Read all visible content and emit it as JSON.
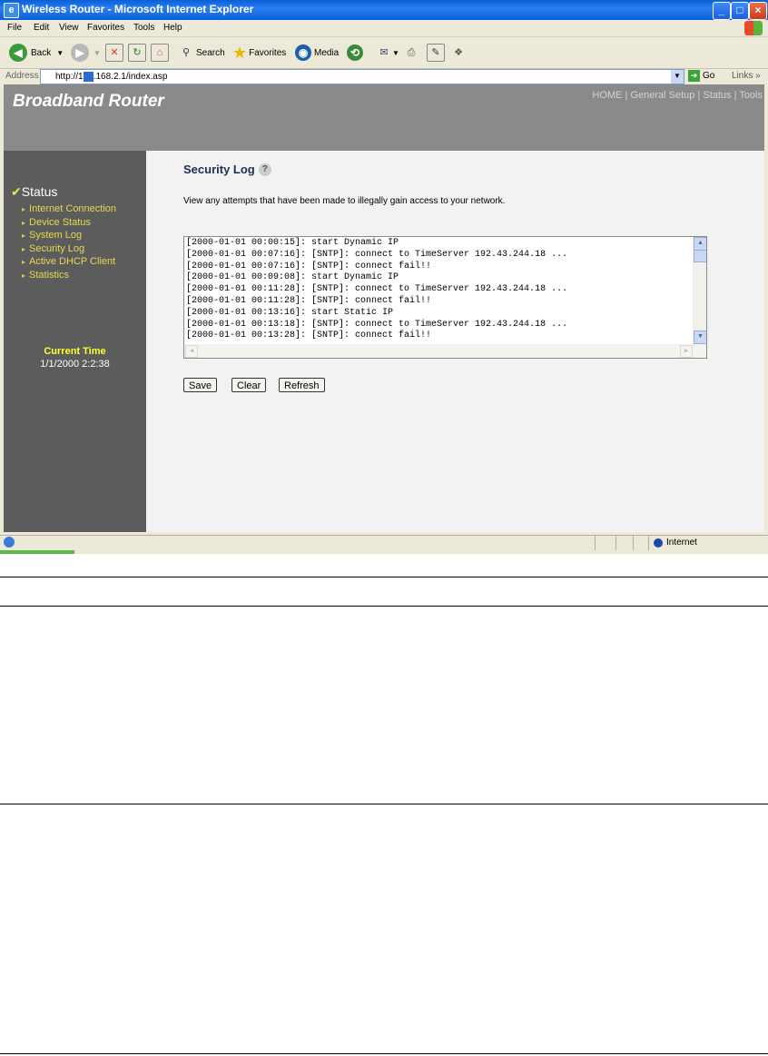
{
  "window": {
    "title": "Wireless Router - Microsoft Internet Explorer"
  },
  "menu": [
    "File",
    "Edit",
    "View",
    "Favorites",
    "Tools",
    "Help"
  ],
  "toolbar": {
    "back": "Back",
    "search": "Search",
    "favorites": "Favorites",
    "media": "Media"
  },
  "address": {
    "label": "Address",
    "url": "http://192.168.2.1/index.asp",
    "go": "Go",
    "links": "Links"
  },
  "header": {
    "brand": "Broadband Router",
    "nav": "HOME | General Setup | Status | Tools"
  },
  "sidebar": {
    "section": "Status",
    "items": [
      "Internet Connection",
      "Device Status",
      "System Log",
      "Security Log",
      "Active DHCP Client",
      "Statistics"
    ],
    "current_time_label": "Current Time",
    "current_time_value": "1/1/2000 2:2:38"
  },
  "main": {
    "title": "Security Log",
    "description": "View any attempts that have been made to illegally gain access to your network.",
    "log_lines": [
      "[2000-01-01 00:00:15]: start Dynamic IP",
      "[2000-01-01 00:07:16]: [SNTP]: connect to TimeServer 192.43.244.18 ...",
      "[2000-01-01 00:07:16]: [SNTP]: connect fail!!",
      "[2000-01-01 00:09:08]: start Dynamic IP",
      "[2000-01-01 00:11:28]: [SNTP]: connect to TimeServer 192.43.244.18 ...",
      "[2000-01-01 00:11:28]: [SNTP]: connect fail!!",
      "[2000-01-01 00:13:16]: start Static IP",
      "[2000-01-01 00:13:18]: [SNTP]: connect to TimeServer 192.43.244.18 ...",
      "[2000-01-01 00:13:28]: [SNTP]: connect fail!!"
    ],
    "buttons": {
      "save": "Save",
      "clear": "Clear",
      "refresh": "Refresh"
    }
  },
  "statusbar": {
    "zone": "Internet"
  }
}
